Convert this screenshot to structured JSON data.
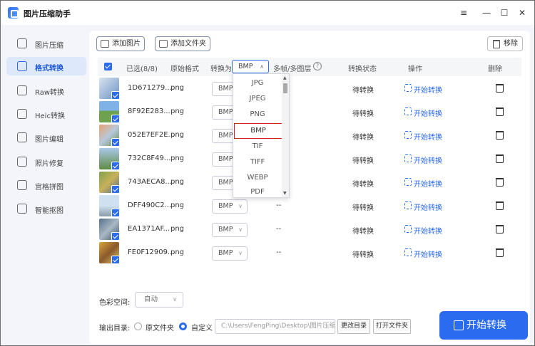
{
  "app": {
    "title": "图片压缩助手"
  },
  "window_controls": {
    "menu": "≡",
    "minimize": "—",
    "maximize": "☐",
    "close": "✕"
  },
  "sidebar": {
    "items": [
      {
        "label": "图片压缩",
        "icon": "image-compress-icon",
        "active": false
      },
      {
        "label": "格式转换",
        "icon": "format-convert-icon",
        "active": true
      },
      {
        "label": "Raw转换",
        "icon": "raw-convert-icon",
        "active": false
      },
      {
        "label": "Heic转换",
        "icon": "heic-convert-icon",
        "active": false
      },
      {
        "label": "图片编辑",
        "icon": "image-edit-icon",
        "active": false
      },
      {
        "label": "照片修复",
        "icon": "photo-repair-icon",
        "active": false
      },
      {
        "label": "宫格拼图",
        "icon": "grid-collage-icon",
        "active": false
      },
      {
        "label": "智能抠图",
        "icon": "smart-cutout-icon",
        "active": false
      }
    ]
  },
  "toolbar": {
    "add_image": "添加图片",
    "add_folder": "添加文件夹",
    "remove": "移除"
  },
  "table": {
    "headers": {
      "selected": "已选(8/8)",
      "original_format": "原始格式",
      "convert_to": "转换为",
      "convert_to_value": "BMP",
      "multi_frame": "多帧/多图层",
      "status": "转换状态",
      "action": "操作",
      "delete": "删除"
    },
    "rows": [
      {
        "name": "1D671279...",
        "format": "png",
        "target": "BMP",
        "frames": "",
        "status": "待转换",
        "action": "开始转换"
      },
      {
        "name": "8F92E283...",
        "format": "png",
        "target": "BMP",
        "frames": "",
        "status": "待转换",
        "action": "开始转换"
      },
      {
        "name": "052E7EF2E...",
        "format": "png",
        "target": "BMP",
        "frames": "",
        "status": "待转换",
        "action": "开始转换"
      },
      {
        "name": "732C8F49...",
        "format": "png",
        "target": "BMP",
        "frames": "",
        "status": "待转换",
        "action": "开始转换"
      },
      {
        "name": "743AECA8...",
        "format": "png",
        "target": "BMP",
        "frames": "",
        "status": "待转换",
        "action": "开始转换"
      },
      {
        "name": "DFF490C2...",
        "format": "png",
        "target": "BMP",
        "frames": "--",
        "status": "待转换",
        "action": "开始转换"
      },
      {
        "name": "EA1371AF...",
        "format": "png",
        "target": "BMP",
        "frames": "--",
        "status": "待转换",
        "action": "开始转换"
      },
      {
        "name": "FE0F12909...",
        "format": "png",
        "target": "BMP",
        "frames": "--",
        "status": "待转换",
        "action": "开始转换"
      }
    ]
  },
  "format_dropdown": {
    "options": [
      "JPG",
      "JPEG",
      "PNG",
      "BMP",
      "TIF",
      "TIFF",
      "WEBP",
      "PDF"
    ],
    "selected": "BMP"
  },
  "bottom": {
    "color_space_label": "色彩空间:",
    "color_space_value": "自动",
    "output_label": "输出目录:",
    "radio_original": "原文件夹",
    "radio_custom": "自定义",
    "path": "C:\\Users\\FengPing\\Desktop\\图片压缩",
    "change_dir": "更改目录",
    "open_folder": "打开文件夹",
    "start_button": "开始转换"
  },
  "colors": {
    "accent": "#2b6bef",
    "selection_border": "#d4242a",
    "sidebar_active_bg": "#dde8fb"
  }
}
